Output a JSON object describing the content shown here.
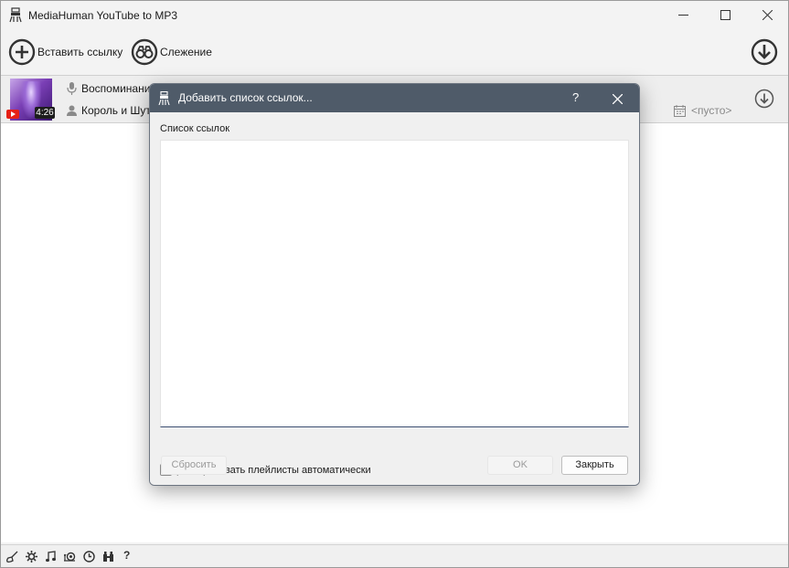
{
  "window": {
    "title": "MediaHuman YouTube to MP3",
    "app_icon": "mediahuman-icon"
  },
  "toolbar": {
    "paste_link_label": "Вставить ссылку",
    "tracking_label": "Слежение",
    "paste_icon": "plus-circle-icon",
    "tracking_icon": "binoculars-icon",
    "download_icon": "download-circle-icon"
  },
  "track": {
    "title": "Воспоминания",
    "artist": "Король и Шут",
    "duration": "4:26",
    "source_badge": "youtube-icon",
    "album_placeholder": "<пусто>"
  },
  "dialog": {
    "title": "Добавить список ссылок...",
    "help_label": "?",
    "list_label": "Список ссылок",
    "textarea_value": "",
    "expand_playlists_label": "разворачивать плейлисты автоматически",
    "expand_playlists_checked": false,
    "reset_label": "Сбросить",
    "ok_label": "OK",
    "close_label": "Закрыть"
  },
  "statusbar": {
    "icons": [
      "broom-icon",
      "gear-icon",
      "music-note-icon",
      "snail-icon",
      "clock-icon",
      "binoculars-icon",
      "help-icon"
    ],
    "help_label": "?"
  },
  "colors": {
    "dialog_titlebar": "#4f5b69",
    "window_bg": "#f3f3f3",
    "list_bg": "#ffffff",
    "row_bg": "#eeeeee"
  }
}
